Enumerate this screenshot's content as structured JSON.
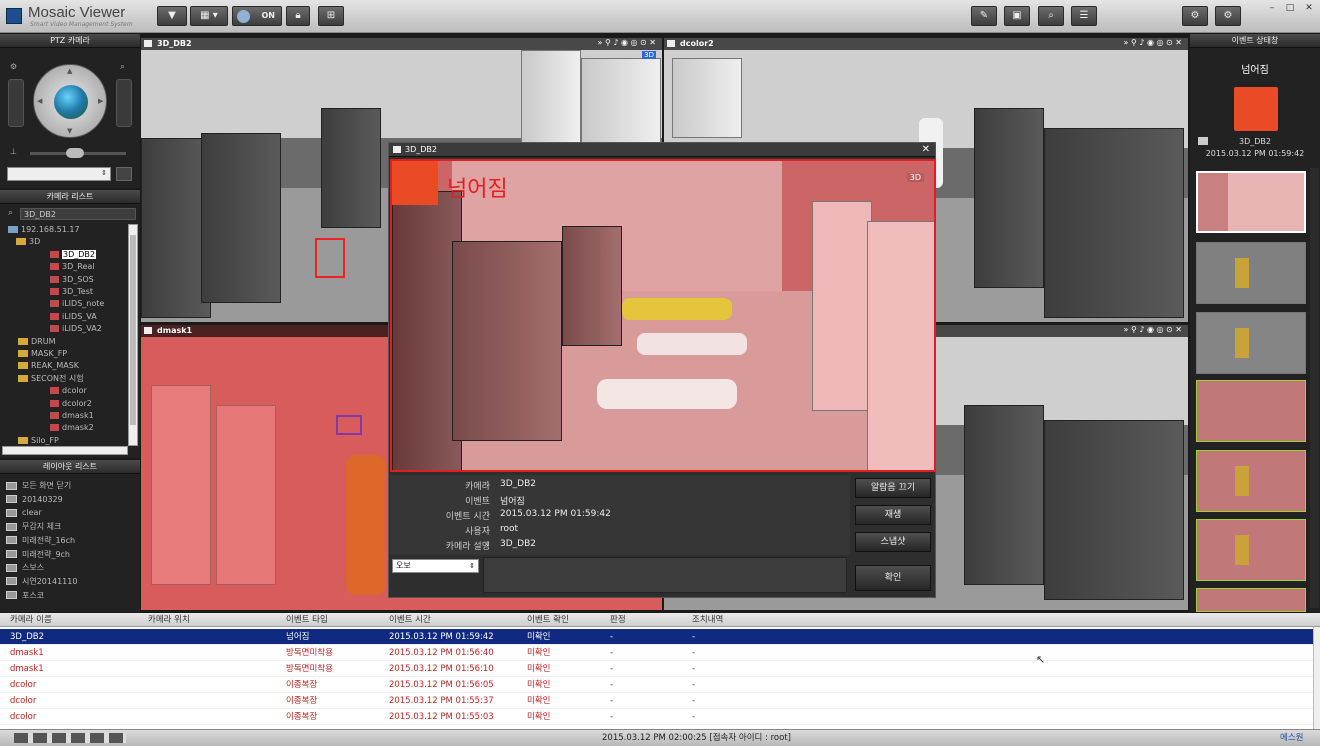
{
  "app": {
    "title": "Mosaic Viewer",
    "subtitle": "Smart Video Management System"
  },
  "toolbar": {
    "toggle_label": "ON"
  },
  "ptz": {
    "title": "PTZ 카메라"
  },
  "camera_list": {
    "title": "카메라 리스트",
    "search_value": "3D_DB2",
    "tree": [
      {
        "label": "192.168.51.17",
        "type": "server"
      },
      {
        "label": "3D",
        "type": "folder"
      },
      {
        "label": "3D_DB2",
        "type": "cam",
        "selected": true
      },
      {
        "label": "3D_Real",
        "type": "cam"
      },
      {
        "label": "3D_SOS",
        "type": "cam"
      },
      {
        "label": "3D_Test",
        "type": "cam"
      },
      {
        "label": "iLIDS_note",
        "type": "cam"
      },
      {
        "label": "iLIDS_VA",
        "type": "cam"
      },
      {
        "label": "iLIDS_VA2",
        "type": "cam"
      },
      {
        "label": "DRUM",
        "type": "folder"
      },
      {
        "label": "MASK_FP",
        "type": "folder"
      },
      {
        "label": "REAK_MASK",
        "type": "folder"
      },
      {
        "label": "SECON전 시험",
        "type": "folder"
      },
      {
        "label": "dcolor",
        "type": "cam"
      },
      {
        "label": "dcolor2",
        "type": "cam"
      },
      {
        "label": "dmask1",
        "type": "cam"
      },
      {
        "label": "dmask2",
        "type": "cam"
      },
      {
        "label": "Silo_FP",
        "type": "folder"
      }
    ]
  },
  "layout_list": {
    "title": "레이아웃 리스트",
    "items": [
      "모든 화면 닫기",
      "20140329",
      "clear",
      "무감지 체크",
      "미래전략_16ch",
      "미래전략_9ch",
      "스보스",
      "시연20141110",
      "포스코"
    ]
  },
  "tiles": [
    {
      "name": "3D_DB2",
      "badge": "3D"
    },
    {
      "name": "dcolor2",
      "badge": ""
    },
    {
      "name": "dmask1",
      "badge": ""
    },
    {
      "name": "",
      "badge": ""
    }
  ],
  "popup": {
    "title": "3D_DB2",
    "event_label": "넘어짐",
    "badge": "3D",
    "fields": [
      {
        "label": "카메라",
        "value": "3D_DB2"
      },
      {
        "label": "이벤트",
        "value": "넘어짐"
      },
      {
        "label": "이벤트 시간",
        "value": "2015.03.12 PM 01:59:42"
      },
      {
        "label": "사용자",
        "value": "root"
      },
      {
        "label": "카메라 설명",
        "value": "3D_DB2"
      }
    ],
    "buttons": {
      "alarm_off": "알람음 끄기",
      "play": "재생",
      "snapshot": "스냅샷",
      "confirm": "확인"
    },
    "select_value": "오보"
  },
  "event_status": {
    "title": "이벤트 상태창",
    "event_name": "넘어짐",
    "camera": "3D_DB2",
    "time": "2015.03.12 PM 01:59:42"
  },
  "event_table": {
    "headers": [
      "카메라 이름",
      "카메라 위치",
      "이벤트 타입",
      "이벤트 시간",
      "이벤트 확인",
      "판정",
      "조치내역"
    ],
    "rows": [
      [
        "3D_DB2",
        "",
        "넘어짐",
        "2015.03.12 PM 01:59:42",
        "미확인",
        "-",
        "-"
      ],
      [
        "dmask1",
        "",
        "방독면미착용",
        "2015.03.12 PM 01:56:40",
        "미확인",
        "-",
        "-"
      ],
      [
        "dmask1",
        "",
        "방독면미착용",
        "2015.03.12 PM 01:56:10",
        "미확인",
        "-",
        "-"
      ],
      [
        "dcolor",
        "",
        "이종복장",
        "2015.03.12 PM 01:56:05",
        "미확인",
        "-",
        "-"
      ],
      [
        "dcolor",
        "",
        "이종복장",
        "2015.03.12 PM 01:55:37",
        "미확인",
        "-",
        "-"
      ],
      [
        "dcolor",
        "",
        "이종복장",
        "2015.03.12 PM 01:55:03",
        "미확인",
        "-",
        "-"
      ]
    ]
  },
  "status_bar": {
    "center": "2015.03.12  PM  02:00:25  [접속자 아이디 : root]",
    "right": "에스원"
  }
}
